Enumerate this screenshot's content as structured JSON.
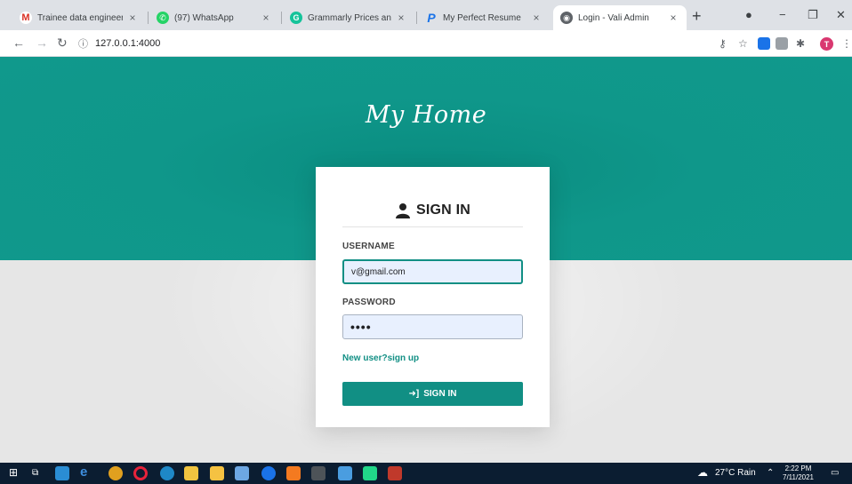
{
  "browser": {
    "tabs": [
      {
        "title": "Trainee data engineer - th",
        "favicon": "gmail-icon",
        "color": "#d93025",
        "active": false
      },
      {
        "title": "(97) WhatsApp",
        "favicon": "whatsapp-icon",
        "color": "#25d366",
        "active": false
      },
      {
        "title": "Grammarly Prices and Pla",
        "favicon": "grammarly-icon",
        "color": "#15c39a",
        "active": false
      },
      {
        "title": "My Perfect Resume",
        "favicon": "myperfectresume-icon",
        "color": "#1a73e8",
        "active": false
      },
      {
        "title": "Login - Vali Admin",
        "favicon": "globe-icon",
        "color": "#5f6368",
        "active": true
      }
    ],
    "url": "127.0.0.1:4000",
    "profile_initial": "T"
  },
  "page": {
    "brand": "My Home",
    "card_title": "SIGN IN",
    "username_label": "USERNAME",
    "username_value": "v@gmail.com",
    "password_label": "PASSWORD",
    "password_value": "••••",
    "signup_link": "New user?sign up",
    "submit_label": "SIGN IN",
    "accent_color": "#118f84",
    "hero_color": "#10998c"
  },
  "taskbar": {
    "weather": "27°C  Rain",
    "time": "2:22 PM",
    "date": "7/11/2021"
  }
}
